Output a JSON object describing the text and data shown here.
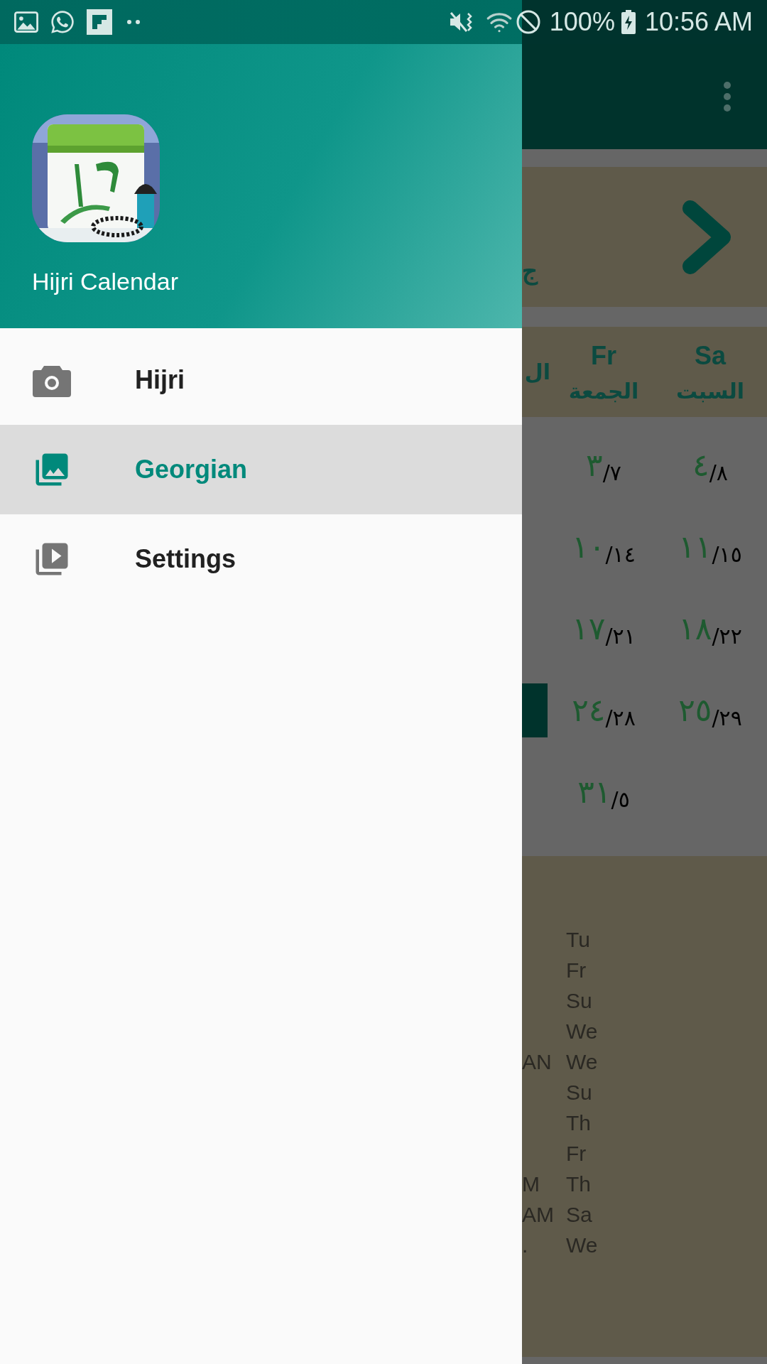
{
  "status_bar": {
    "battery": "100%",
    "time": "10:56 AM"
  },
  "drawer": {
    "title": "Hijri Calendar",
    "items": [
      {
        "label": "Hijri",
        "kind": "camera",
        "selected": false
      },
      {
        "label": "Georgian",
        "kind": "images",
        "selected": true
      },
      {
        "label": "Settings",
        "kind": "video",
        "selected": false
      }
    ]
  },
  "background": {
    "month_card": {
      "column_1": "ج"
    },
    "weekdays": [
      {
        "english": "Sa",
        "arabic": "السبت"
      },
      {
        "english": "Fr",
        "arabic": "الجمعة"
      },
      {
        "arabic": "ال"
      }
    ],
    "rows": [
      {
        "cut_cell_selected": false,
        "cells": [
          {
            "kind": "day",
            "hijri": "٤",
            "gregorian": "/٨"
          },
          {
            "kind": "day",
            "hijri": "٣",
            "gregorian": "/٧"
          }
        ]
      },
      {
        "cut_cell_selected": false,
        "cells": [
          {
            "kind": "day",
            "hijri": "١١",
            "gregorian": "/١٥"
          },
          {
            "kind": "day",
            "hijri": "١٠",
            "gregorian": "/١٤"
          }
        ]
      },
      {
        "cut_cell_selected": false,
        "cells": [
          {
            "kind": "day",
            "hijri": "١٨",
            "gregorian": "/٢٢"
          },
          {
            "kind": "day",
            "hijri": "١٧",
            "gregorian": "/٢١"
          }
        ]
      },
      {
        "cut_cell_selected": true,
        "cells": [
          {
            "kind": "day",
            "hijri": "٢٥",
            "gregorian": "/٢٩"
          },
          {
            "kind": "day",
            "hijri": "٢٤",
            "gregorian": "/٢٨"
          }
        ]
      },
      {
        "cut_cell_selected": false,
        "cells": [
          {
            "kind": "blank"
          },
          {
            "kind": "day",
            "hijri": "٣١",
            "gregorian": "/٥"
          }
        ]
      }
    ],
    "list": [
      {
        "day": "Tu"
      },
      {
        "day": "Fr"
      },
      {
        "day": "Su"
      },
      {
        "day": "We"
      },
      {
        "column_1": "AN",
        "day": "We"
      },
      {
        "day": "Su"
      },
      {
        "day": "Th"
      },
      {
        "day": "Fr"
      },
      {
        "column_1": "M",
        "day": "Th"
      },
      {
        "column_1": "AM",
        "day": "Sa"
      },
      {
        "column_1": ".",
        "day": "We"
      }
    ]
  }
}
